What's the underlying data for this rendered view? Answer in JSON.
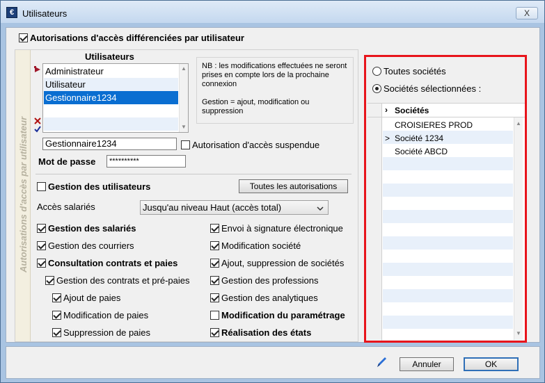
{
  "window": {
    "title": "Utilisateurs",
    "close": "X",
    "app_icon": "€"
  },
  "main_checkbox": {
    "label": "Autorisations d'accès différenciées par utilisateur",
    "checked": true
  },
  "vertical_label": "Autorisations d'accès par utilisateur",
  "users": {
    "header": "Utilisateurs",
    "items": [
      "Administrateur",
      "Utilisateur",
      "Gestionnaire1234"
    ],
    "selected_index": 2,
    "side_icons": [
      "add-user-icon",
      "delete-user-icon",
      "validate-icon"
    ]
  },
  "note": {
    "line1": "NB : les modifications effectuées ne seront prises en compte lors de la prochaine connexion",
    "line2": "Gestion = ajout, modification ou suppression"
  },
  "username_field": {
    "value": "Gestionnaire1234"
  },
  "suspended": {
    "label": "Autorisation d'accès suspendue",
    "checked": false
  },
  "password": {
    "label": "Mot de passe",
    "value": "**********"
  },
  "gestion_utilisateurs": {
    "label": "Gestion des utilisateurs",
    "checked": false
  },
  "toutes_autorisations_button": "Toutes les autorisations",
  "acces_salaries": {
    "label": "Accès salariés",
    "value": "Jusqu'au niveau Haut (accès total)"
  },
  "left_perms": [
    {
      "label": "Gestion des salariés",
      "checked": true,
      "bold": true
    },
    {
      "label": "Gestion des courriers",
      "checked": true,
      "bold": false
    },
    {
      "label": "Consultation contrats et paies",
      "checked": true,
      "bold": true
    },
    {
      "label": "Gestion des contrats et pré-paies",
      "checked": true,
      "bold": false
    },
    {
      "label": "Ajout de paies",
      "checked": true,
      "bold": false
    },
    {
      "label": "Modification de paies",
      "checked": true,
      "bold": false
    },
    {
      "label": "Suppression de paies",
      "checked": true,
      "bold": false
    }
  ],
  "right_perms": [
    {
      "label": "Envoi à signature électronique",
      "checked": true,
      "bold": false
    },
    {
      "label": "Modification société",
      "checked": true,
      "bold": false
    },
    {
      "label": "Ajout, suppression de sociétés",
      "checked": true,
      "bold": false
    },
    {
      "label": "Gestion des professions",
      "checked": true,
      "bold": false
    },
    {
      "label": "Gestion des analytiques",
      "checked": true,
      "bold": false
    },
    {
      "label": "Modification du paramétrage",
      "checked": false,
      "bold": true
    },
    {
      "label": "Réalisation des états",
      "checked": true,
      "bold": true
    }
  ],
  "societes": {
    "radio_all": "Toutes sociétés",
    "radio_selected": "Sociétés sélectionnées :",
    "selected_mode": "selected",
    "grid_header": "Sociétés",
    "header_marker": "›",
    "current_marker": ">",
    "items": [
      "CROISIERES PROD",
      "Société 1234",
      "Société ABCD"
    ],
    "current_index": 1
  },
  "footer": {
    "cancel": "Annuler",
    "ok": "OK",
    "edit_icon": "pen-icon"
  },
  "colors": {
    "highlight_border": "#e8141b",
    "selection": "#0a6ed1",
    "stripe": "#e8f0fa"
  }
}
